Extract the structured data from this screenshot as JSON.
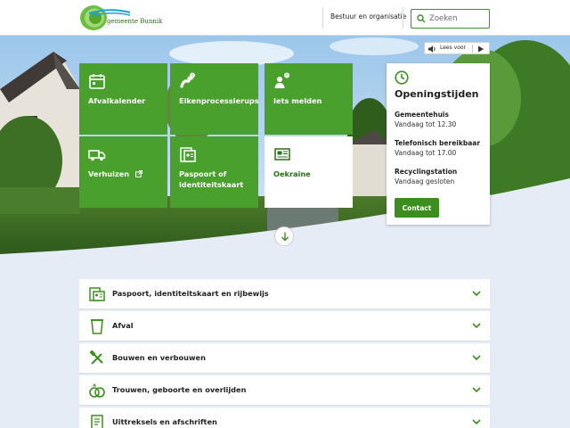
{
  "header": {
    "logo_text": "gemeente Bunnik",
    "nav_link": "Bestuur en organisatie",
    "search": {
      "placeholder": "Zoeken"
    }
  },
  "readspeaker": {
    "label": "Lees voor"
  },
  "tiles": [
    {
      "label": "Afvalkalender",
      "icon": "calendar-icon"
    },
    {
      "label": "Eikenprocessierups",
      "icon": "caterpillar-icon"
    },
    {
      "label": "Iets melden",
      "icon": "report-person-icon"
    },
    {
      "label": "Verhuizen",
      "icon": "moving-truck-icon"
    },
    {
      "label": "Paspoort of identiteitskaart",
      "icon": "passport-icon"
    },
    {
      "label": "Oekraïne",
      "icon": "news-icon"
    }
  ],
  "opening_hours": {
    "title": "Openingstijden",
    "entries": [
      {
        "location": "Gemeentehuis",
        "time": "Vandaag tot 12.30"
      },
      {
        "location": "Telefonisch bereikbaar",
        "time": "Vandaag tot 17.00"
      },
      {
        "location": "Recyclingstation",
        "time": "Vandaag gesloten"
      }
    ],
    "contact_label": "Contact"
  },
  "accordion": [
    {
      "label": "Paspoort, identiteitskaart en rijbewijs",
      "icon": "id-card-icon"
    },
    {
      "label": "Afval",
      "icon": "waste-bin-icon"
    },
    {
      "label": "Bouwen en verbouwen",
      "icon": "tools-icon"
    },
    {
      "label": "Trouwen, geboorte en overlijden",
      "icon": "rings-icon"
    },
    {
      "label": "Uittreksels en afschriften",
      "icon": "document-icon"
    }
  ],
  "colors": {
    "brand_green": "#4aa02c",
    "button_green": "#3c8f1e",
    "page_background": "#e6ecf5"
  }
}
